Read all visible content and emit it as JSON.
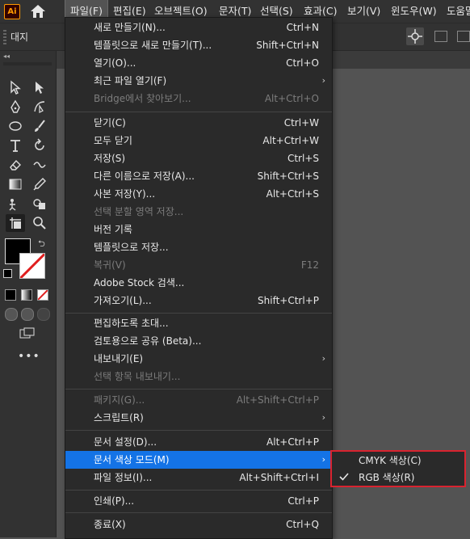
{
  "app": {
    "logo_text": "Ai"
  },
  "menubar": {
    "items": [
      "파일(F)",
      "편집(E)",
      "오브젝트(O)",
      "문자(T)",
      "선택(S)",
      "효과(C)",
      "보기(V)",
      "윈도우(W)",
      "도움말"
    ]
  },
  "controlbar": {
    "label": "대지"
  },
  "file_menu": {
    "items": [
      {
        "label": "새로 만들기(N)...",
        "shortcut": "Ctrl+N",
        "enabled": true
      },
      {
        "label": "템플릿으로 새로 만들기(T)...",
        "shortcut": "Shift+Ctrl+N",
        "enabled": true
      },
      {
        "label": "열기(O)...",
        "shortcut": "Ctrl+O",
        "enabled": true
      },
      {
        "label": "최근 파일 열기(F)",
        "shortcut": "",
        "submenu": true,
        "enabled": true
      },
      {
        "label": "Bridge에서 찾아보기...",
        "shortcut": "Alt+Ctrl+O",
        "enabled": false
      },
      {
        "label": "닫기(C)",
        "shortcut": "Ctrl+W",
        "enabled": true
      },
      {
        "label": "모두 닫기",
        "shortcut": "Alt+Ctrl+W",
        "enabled": true
      },
      {
        "label": "저장(S)",
        "shortcut": "Ctrl+S",
        "enabled": true
      },
      {
        "label": "다른 이름으로 저장(A)...",
        "shortcut": "Shift+Ctrl+S",
        "enabled": true
      },
      {
        "label": "사본 저장(Y)...",
        "shortcut": "Alt+Ctrl+S",
        "enabled": true
      },
      {
        "label": "선택 분할 영역 저장...",
        "shortcut": "",
        "enabled": false
      },
      {
        "label": "버전 기록",
        "shortcut": "",
        "enabled": true
      },
      {
        "label": "템플릿으로 저장...",
        "shortcut": "",
        "enabled": true
      },
      {
        "label": "복귀(V)",
        "shortcut": "F12",
        "enabled": false
      },
      {
        "label": "Adobe Stock 검색...",
        "shortcut": "",
        "enabled": true
      },
      {
        "label": "가져오기(L)...",
        "shortcut": "Shift+Ctrl+P",
        "enabled": true
      },
      {
        "label": "편집하도록 초대...",
        "shortcut": "",
        "enabled": true
      },
      {
        "label": "검토용으로 공유 (Beta)...",
        "shortcut": "",
        "enabled": true
      },
      {
        "label": "내보내기(E)",
        "shortcut": "",
        "submenu": true,
        "enabled": true
      },
      {
        "label": "선택 항목 내보내기...",
        "shortcut": "",
        "enabled": false
      },
      {
        "label": "패키지(G)...",
        "shortcut": "Alt+Shift+Ctrl+P",
        "enabled": false
      },
      {
        "label": "스크립트(R)",
        "shortcut": "",
        "submenu": true,
        "enabled": true
      },
      {
        "label": "문서 설정(D)...",
        "shortcut": "Alt+Ctrl+P",
        "enabled": true
      },
      {
        "label": "문서 색상 모드(M)",
        "shortcut": "",
        "submenu": true,
        "enabled": true,
        "highlighted": true
      },
      {
        "label": "파일 정보(I)...",
        "shortcut": "Alt+Shift+Ctrl+I",
        "enabled": true
      },
      {
        "label": "인쇄(P)...",
        "shortcut": "Ctrl+P",
        "enabled": true
      },
      {
        "label": "종료(X)",
        "shortcut": "Ctrl+Q",
        "enabled": true
      }
    ]
  },
  "color_mode_submenu": {
    "items": [
      {
        "label": "CMYK 색상(C)",
        "checked": false
      },
      {
        "label": "RGB 색상(R)",
        "checked": true
      }
    ]
  },
  "colors": {
    "highlight": "#1473e6",
    "annotation_border": "#d9232f",
    "stroke_slash": "#e02020"
  }
}
